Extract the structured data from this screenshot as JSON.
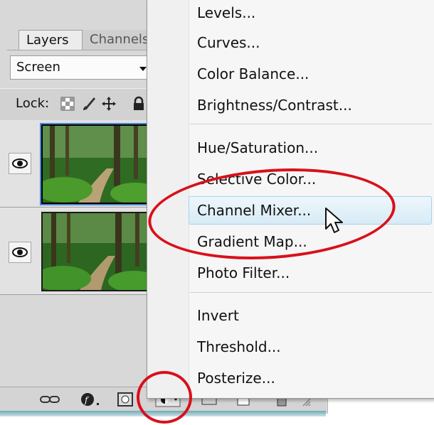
{
  "layers_panel": {
    "tabs": [
      "Layers",
      "Channels"
    ],
    "blend_mode": "Screen",
    "lock_label": "Lock:",
    "layer_count": 2
  },
  "adjustment_menu": {
    "groups": [
      [
        "Levels...",
        "Curves...",
        "Color Balance...",
        "Brightness/Contrast..."
      ],
      [
        "Hue/Saturation...",
        "Selective Color...",
        "Channel Mixer...",
        "Gradient Map...",
        "Photo Filter..."
      ],
      [
        "Invert",
        "Threshold...",
        "Posterize..."
      ]
    ],
    "highlighted_item": "Channel Mixer..."
  },
  "colors": {
    "annotation_red": "#d9101a",
    "menu_highlight": "#d7ebf6",
    "panel_bg": "#d8d8d8"
  },
  "icons": [
    "eye-icon",
    "link-icon",
    "fx-icon",
    "mask-icon",
    "adjustment-layer-icon",
    "new-layer-icon",
    "trash-icon",
    "mouse-pointer-icon"
  ]
}
